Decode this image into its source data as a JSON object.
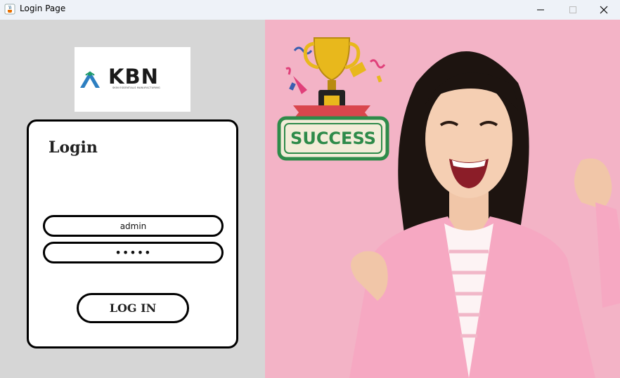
{
  "window": {
    "title": "Login Page",
    "app_icon": "java-coffee-icon",
    "controls": [
      "minimize-icon",
      "maximize-icon",
      "close-icon"
    ]
  },
  "logo": {
    "brand": "KBN",
    "tagline": "SKIN ESSENTIALS MANUFACTURING"
  },
  "login": {
    "title": "Login",
    "username_value": "admin",
    "password_value": "•••••",
    "button_label": "LOG IN"
  },
  "hero": {
    "stamp_text": "SUCCESS",
    "illustration": "smiling-woman-celebrating",
    "trophy": "trophy-icon"
  },
  "colors": {
    "left_panel": "#d6d6d6",
    "hero_background": "#f3b3c6",
    "stamp_green": "#2e8b4a",
    "trophy_gold": "#e8b81c"
  }
}
